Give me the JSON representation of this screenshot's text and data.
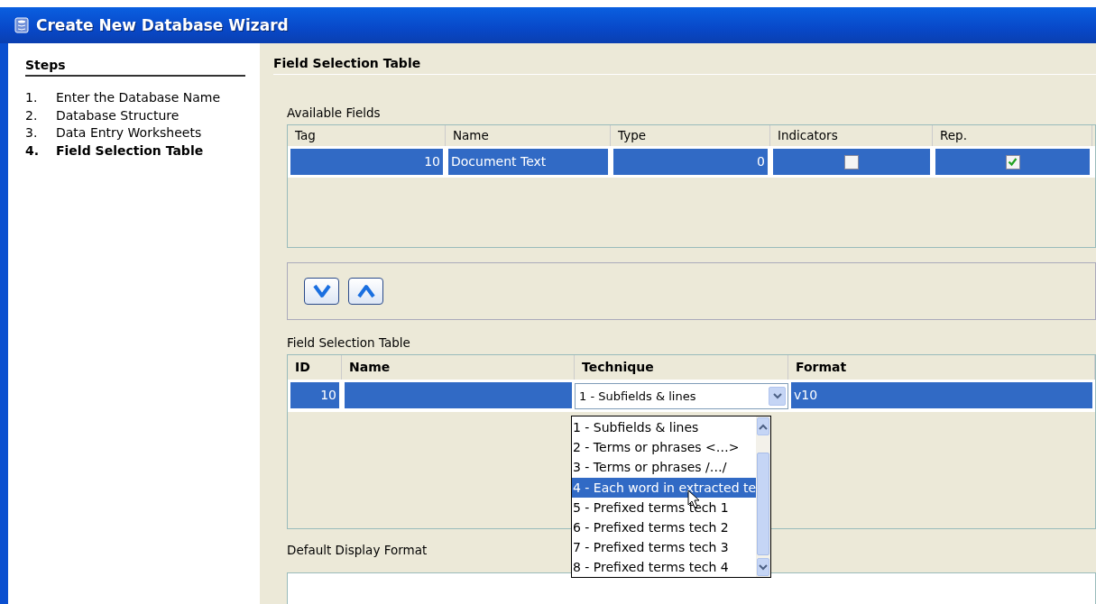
{
  "window": {
    "title": "Create New Database Wizard"
  },
  "steps": {
    "heading": "Steps",
    "items": [
      {
        "number": "1.",
        "label": "Enter the Database Name",
        "selected": false
      },
      {
        "number": "2.",
        "label": "Database Structure",
        "selected": false
      },
      {
        "number": "3.",
        "label": "Data Entry Worksheets",
        "selected": false
      },
      {
        "number": "4.",
        "label": "Field Selection Table",
        "selected": true
      }
    ]
  },
  "page_heading": "Field Selection Table",
  "available_fields": {
    "label": "Available Fields",
    "columns": [
      "Tag",
      "Name",
      "Type",
      "Indicators",
      "Rep."
    ],
    "rows": [
      {
        "tag": "10",
        "name": "Document Text",
        "type": "0",
        "indicators": false,
        "rep": true,
        "selected": true
      }
    ]
  },
  "field_selection": {
    "label": "Field Selection Table",
    "columns": [
      "ID",
      "Name",
      "Technique",
      "Format"
    ],
    "rows": [
      {
        "id": "10",
        "name": "",
        "technique": "1 - Subfields & lines",
        "format": "v10",
        "selected": true
      }
    ],
    "dropdown_options": [
      {
        "label": "1 - Subfields & lines",
        "selected": false
      },
      {
        "label": "2 - Terms or phrases <…>",
        "selected": false
      },
      {
        "label": "3 - Terms or phrases /…/",
        "selected": false
      },
      {
        "label": "4 - Each word in extracted te",
        "selected": true
      },
      {
        "label": "5 - Prefixed terms tech 1",
        "selected": false
      },
      {
        "label": "6 - Prefixed terms tech 2",
        "selected": false
      },
      {
        "label": "7 - Prefixed terms tech 3",
        "selected": false
      },
      {
        "label": "8 - Prefixed terms tech 4",
        "selected": false
      }
    ]
  },
  "default_display_format": {
    "label": "Default Display Format"
  }
}
